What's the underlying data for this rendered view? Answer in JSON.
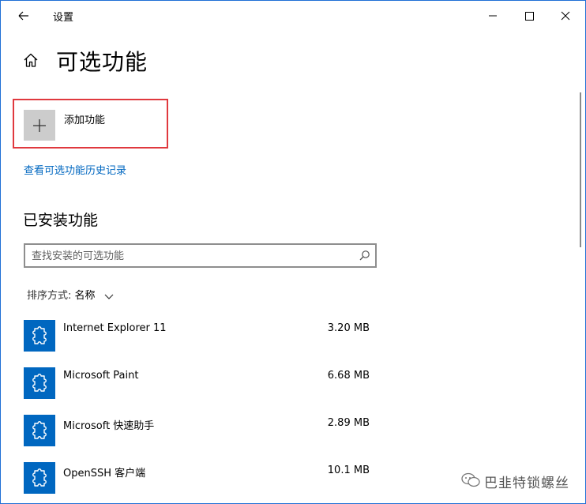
{
  "window": {
    "title": "设置",
    "controls": [
      "minimize",
      "maximize",
      "close"
    ],
    "frame_color": "#1f6fd6"
  },
  "page": {
    "title": "可选功能"
  },
  "add_feature": {
    "label": "添加功能",
    "highlight_color": "#e0393e"
  },
  "history_link": {
    "label": "查看可选功能历史记录",
    "color": "#0067c0"
  },
  "installed": {
    "section_title": "已安装功能",
    "search": {
      "placeholder": "查找安装的可选功能",
      "value": ""
    },
    "sort": {
      "label": "排序方式:",
      "value": "名称"
    },
    "items": [
      {
        "name": "Internet Explorer 11",
        "size": "3.20 MB",
        "icon": "puzzle-icon"
      },
      {
        "name": "Microsoft Paint",
        "size": "6.68 MB",
        "icon": "puzzle-icon"
      },
      {
        "name": "Microsoft 快速助手",
        "size": "2.89 MB",
        "icon": "puzzle-icon"
      },
      {
        "name": "OpenSSH 客户端",
        "size": "10.1 MB",
        "icon": "puzzle-icon"
      }
    ],
    "tile_color": "#0067c0"
  },
  "watermark": {
    "text": "巴韭特锁螺丝"
  }
}
